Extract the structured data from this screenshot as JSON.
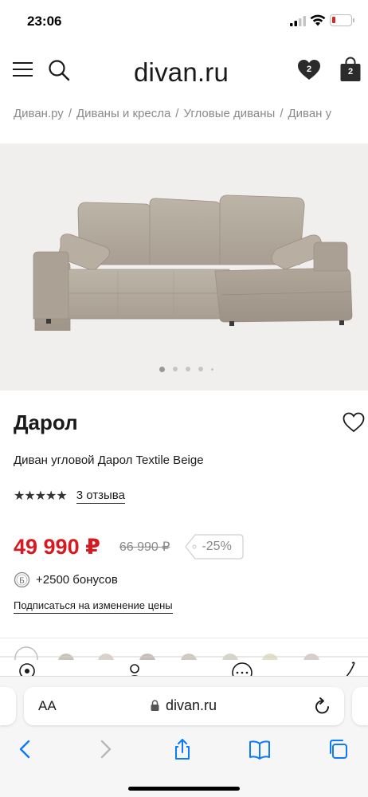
{
  "status_bar": {
    "time": "23:06"
  },
  "header": {
    "logo": "divan.ru",
    "favorites_count": "2",
    "cart_count": "2"
  },
  "breadcrumb": [
    "Диван.ру",
    "Диваны и кресла",
    "Угловые диваны",
    "Диван у"
  ],
  "gallery": {
    "slides_total": 5,
    "active_slide": 1
  },
  "product": {
    "title": "Дарол",
    "subtitle": "Диван угловой Дарол Textile Beige",
    "stars": "★★★★★",
    "reviews": "3 отзыва",
    "price": "49 990 ₽",
    "old_price": "66 990 ₽",
    "discount": "-25%",
    "bonus_badge": "Б",
    "bonus_text": "+2500 бонусов",
    "subscribe": "Подписаться на изменение цены"
  },
  "safari": {
    "text_size_label": "AA",
    "url": "divan.ru"
  },
  "colors": {
    "price_red": "#d71920",
    "gallery_bg": "#f0efed",
    "sofa_fabric": "#b3a99d",
    "text": "#1a1a1a",
    "muted": "#8a8a8a",
    "ios_blue": "#0a7aff"
  },
  "icons": {
    "menu": "hamburger-icon",
    "search": "search-icon",
    "favorites": "heart-icon",
    "cart": "bag-icon",
    "back": "chevron-left-icon",
    "forward": "chevron-right-icon",
    "share": "share-icon",
    "bookmarks": "book-icon",
    "tabs": "tabs-icon"
  }
}
